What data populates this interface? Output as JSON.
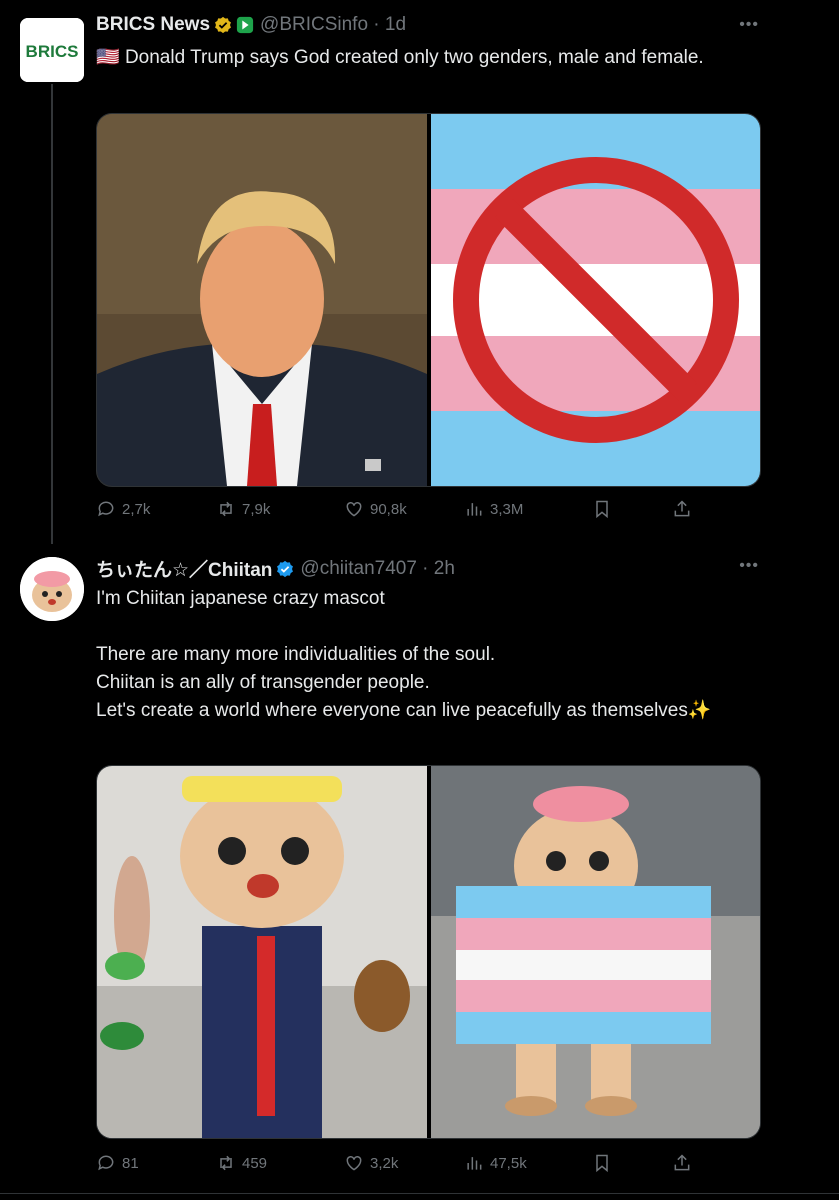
{
  "tweets": [
    {
      "name": "BRICS News",
      "handle": "@BRICSinfo · 1d",
      "avatar_text": "BRICS",
      "flag": "🇺🇸",
      "text": "Donald Trump says God created only two genders, male and female.",
      "stats": {
        "replies": "2,7k",
        "retweets": "7,9k",
        "likes": "90,8k",
        "views": "3,3M"
      }
    },
    {
      "name": "ちぃたん☆／Chiitan",
      "handle": "@chiitan7407 · 2h",
      "text_lines": [
        "I'm Chiitan japanese crazy mascot",
        "",
        "There are many more individualities of the soul.",
        "Chiitan is an ally of transgender people.",
        "Let's create a world where everyone can live peacefully as themselves✨"
      ],
      "stats": {
        "replies": "81",
        "retweets": "459",
        "likes": "3,2k",
        "views": "47,5k"
      }
    }
  ],
  "icons": [
    "more-icon",
    "reply-icon",
    "retweet-icon",
    "like-icon",
    "views-icon",
    "bookmark-icon",
    "share-icon",
    "verified-gold-icon",
    "verified-blue-icon"
  ],
  "colors": {
    "background": "#000000",
    "muted": "#71767b",
    "text": "#e7e9ea",
    "trans_blue": "#7ccaf0",
    "trans_pink": "#f0a7bb",
    "verified_blue": "#1d9bf0",
    "verified_gold": "#e2b719"
  }
}
